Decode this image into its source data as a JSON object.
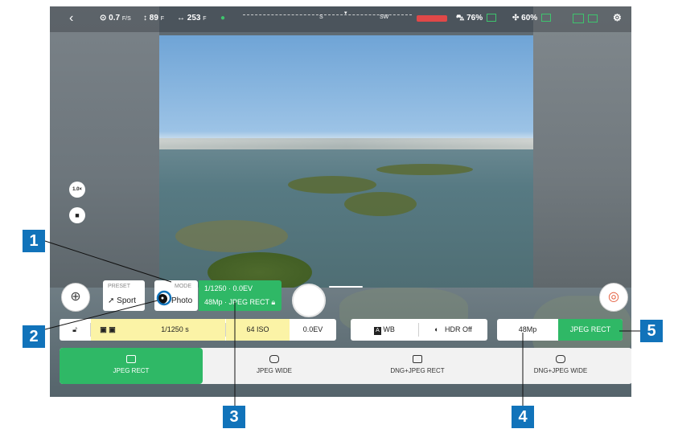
{
  "topbar": {
    "back_icon": "chevron-left-icon",
    "speed": "0.7",
    "speed_unit": "F/S",
    "altitude": "89",
    "altitude_unit": "F",
    "distance": "253",
    "distance_unit": "F",
    "compass_s": "S",
    "compass_sw": "SW",
    "drone_battery": "76%",
    "controller_battery": "60%",
    "settings_icon": "gear-icon"
  },
  "left_buttons": {
    "zoom": "1.0×"
  },
  "preset": {
    "label": "PRESET",
    "value": "Sport"
  },
  "mode": {
    "label": "MODE",
    "value": "Photo"
  },
  "exposure_summary": {
    "line1": "1/1250 · 0.0EV",
    "line2": "48Mp · JPEG RECT"
  },
  "settings_row": {
    "shutter": "1/1250 s",
    "iso": "64 ISO",
    "ev": "0.0EV",
    "wb": "WB",
    "hdr": "HDR Off",
    "resolution": "48Mp",
    "format": "JPEG RECT"
  },
  "formats": [
    {
      "label": "JPEG RECT",
      "active": true
    },
    {
      "label": "JPEG WIDE",
      "active": false
    },
    {
      "label": "DNG+JPEG RECT",
      "active": false
    },
    {
      "label": "DNG+JPEG WIDE",
      "active": false
    }
  ],
  "callouts": [
    "1",
    "2",
    "3",
    "4",
    "5"
  ],
  "colors": {
    "accent_green": "#2fb866",
    "callout_blue": "#1173ba",
    "highlight_yellow": "#fbf3a6"
  }
}
